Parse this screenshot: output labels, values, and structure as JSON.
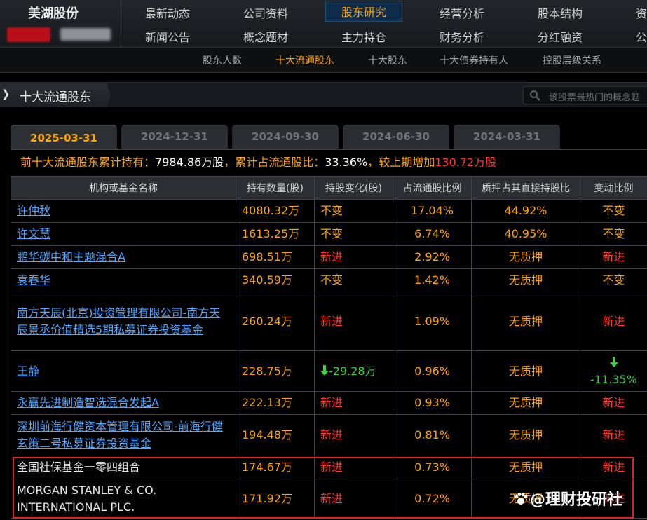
{
  "brand": {
    "name": "美湖股份"
  },
  "nav": {
    "row1": [
      "最新动态",
      "公司资料",
      "股东研究",
      "经营分析",
      "股本结构",
      "资"
    ],
    "row2": [
      "新闻公告",
      "概念题材",
      "主力持仓",
      "财务分析",
      "分红融资",
      "公"
    ],
    "active": "股东研究"
  },
  "subnav": {
    "items": [
      "股东人数",
      "十大流通股东",
      "十大股东",
      "十大债券持有人",
      "控股层级关系"
    ],
    "active": "十大流通股东"
  },
  "breadcrumb": {
    "title": "十大流通股东"
  },
  "search": {
    "placeholder": "该股票最热门的概念题"
  },
  "date_tabs": [
    "2025-03-31",
    "2024-12-31",
    "2024-09-30",
    "2024-06-30",
    "2024-03-31"
  ],
  "summary": {
    "p1": "前十大流通股东累计持有：",
    "v1": "7984.86万股",
    "p2": "，累计占流通股比：",
    "v2": "33.36%",
    "p3": "，较上期增加",
    "v3": "130.72万股"
  },
  "table": {
    "headers": [
      "机构或基金名称",
      "持有数量(股)",
      "持股变化(股)",
      "占流通股比例",
      "质押占其直接持股比",
      "变动比例"
    ],
    "rows": [
      {
        "name": "许仲秋",
        "qty": "4080.32万",
        "change": "不变",
        "ratio": "17.04%",
        "pledge": "44.92%",
        "change_pct": "不变"
      },
      {
        "name": "许文慧",
        "qty": "1613.25万",
        "change": "不变",
        "ratio": "6.74%",
        "pledge": "40.95%",
        "change_pct": "不变"
      },
      {
        "name": "鹏华碳中和主题混合A",
        "qty": "698.51万",
        "change": "新进",
        "ratio": "2.92%",
        "pledge": "无质押",
        "change_pct": "新进"
      },
      {
        "name": "袁春华",
        "qty": "340.59万",
        "change": "不变",
        "ratio": "1.42%",
        "pledge": "无质押",
        "change_pct": "不变"
      },
      {
        "name": "南方天辰(北京)投资管理有限公司-南方天辰景丞价值精选5期私募证券投资基金",
        "qty": "260.24万",
        "change": "新进",
        "ratio": "1.09%",
        "pledge": "无质押",
        "change_pct": "新进"
      },
      {
        "name": "王静",
        "qty": "228.75万",
        "change": "-29.28万",
        "ratio": "0.96%",
        "pledge": "无质押",
        "change_pct": "-11.35%"
      },
      {
        "name": "永赢先进制造智选混合发起A",
        "qty": "222.13万",
        "change": "新进",
        "ratio": "0.93%",
        "pledge": "无质押",
        "change_pct": "新进"
      },
      {
        "name": "深圳前海行健资本管理有限公司-前海行健玄策二号私募证券投资基金",
        "qty": "194.48万",
        "change": "新进",
        "ratio": "0.81%",
        "pledge": "无质押",
        "change_pct": "新进"
      },
      {
        "name": "全国社保基金一零四组合",
        "qty": "174.67万",
        "change": "新进",
        "ratio": "0.73%",
        "pledge": "无质押",
        "change_pct": "新进"
      },
      {
        "name": "MORGAN STANLEY & CO. INTERNATIONAL PLC.",
        "qty": "171.92万",
        "change": "新进",
        "ratio": "0.72%",
        "pledge": "无质押",
        "change_pct": "新进"
      }
    ]
  },
  "watermark": {
    "text": "@理财投研社"
  },
  "colors": {
    "accent": "#ffa500",
    "link": "#4fa6ff",
    "new": "#ff3b30",
    "down": "#3fd13f",
    "highlight_box": "#e02020"
  }
}
